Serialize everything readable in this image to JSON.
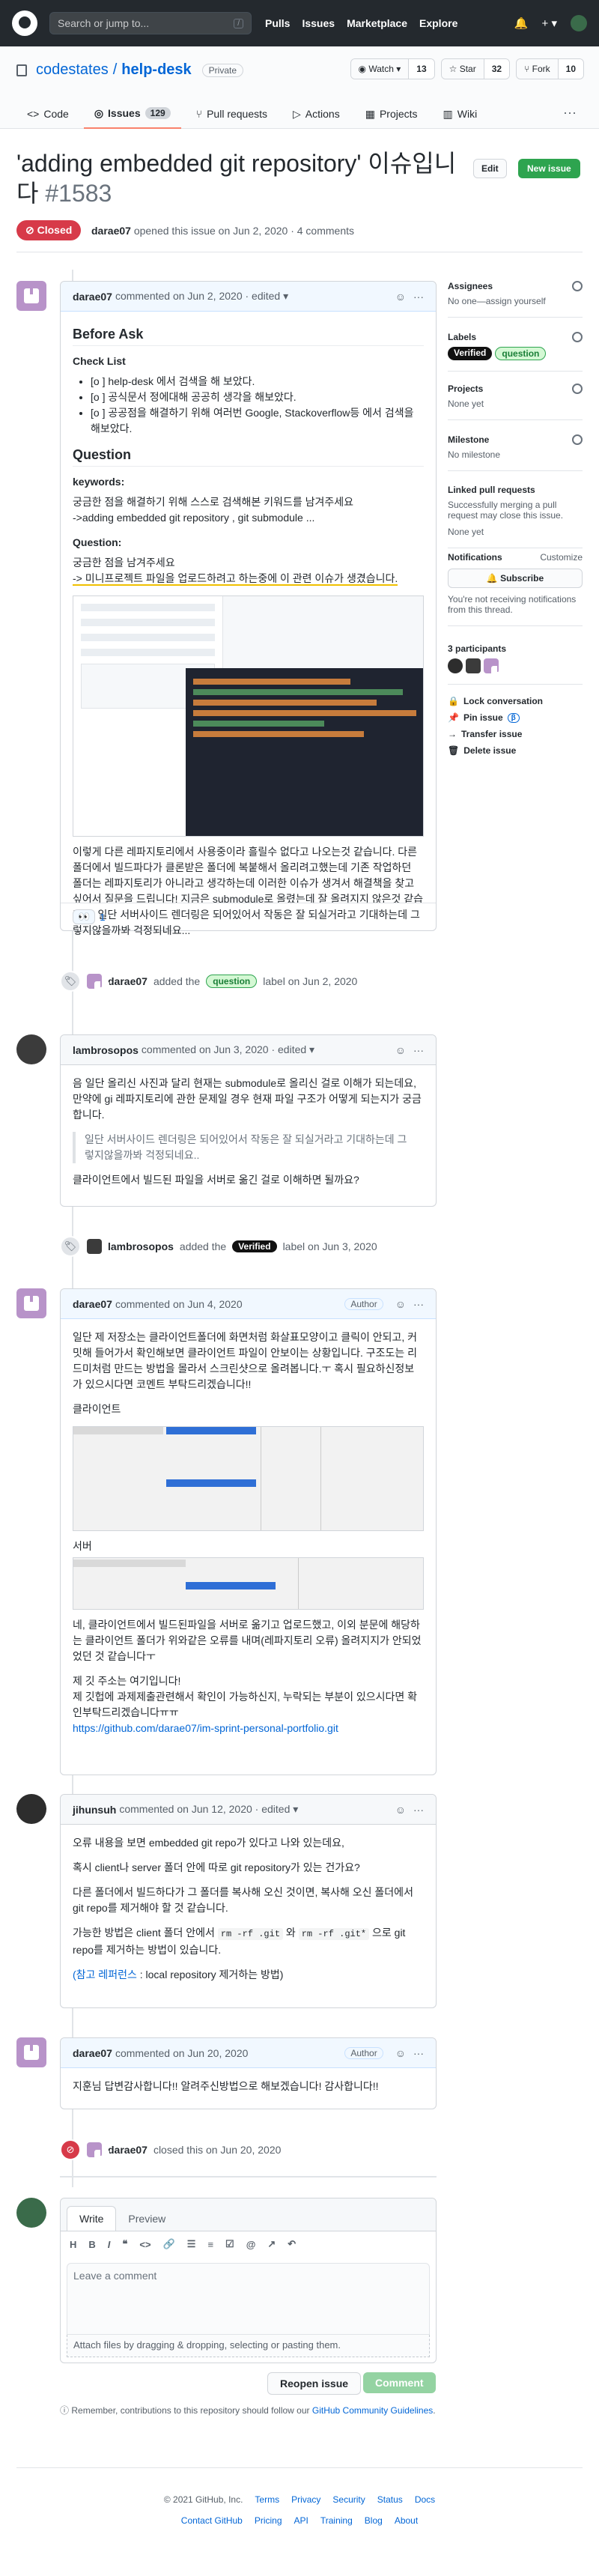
{
  "topbar": {
    "search_placeholder": "Search or jump to...",
    "slash": "/",
    "nav": [
      "Pulls",
      "Issues",
      "Marketplace",
      "Explore"
    ],
    "plus": "+ ▾"
  },
  "repo": {
    "owner": "codestates",
    "slash": "/",
    "name": "help-desk",
    "visibility": "Private",
    "watch": {
      "label": "◉ Watch ▾",
      "count": "13"
    },
    "star": {
      "label": "☆ Star",
      "count": "32"
    },
    "fork": {
      "label": "⑂ Fork",
      "count": "10"
    },
    "tabs": [
      {
        "label": "Code"
      },
      {
        "label": "Issues",
        "count": "129"
      },
      {
        "label": "Pull requests"
      },
      {
        "label": "Actions"
      },
      {
        "label": "Projects"
      },
      {
        "label": "Wiki"
      }
    ],
    "more": "···"
  },
  "issue": {
    "title": "'adding embedded git repository' 이슈입니다",
    "number": "#1583",
    "edit": "Edit",
    "new_issue": "New issue",
    "state": "⊘ Closed",
    "meta_user": "darae07",
    "meta_text": "opened this issue on Jun 2, 2020 · 4 comments"
  },
  "comments": [
    {
      "user": "darae07",
      "header": "commented on Jun 2, 2020 · edited ▾",
      "h_before": "Before Ask",
      "h_check": "Check List",
      "checks": [
        "[o ] help-desk 에서 검색을 해 보았다.",
        "[o ] 공식문서 정에대해 공공히 생각을 해보았다.",
        "[o ] 공공점을 해결하기 위해 여러번 Google, Stackoverflow등 에서 검색을 해보았다."
      ],
      "h_question": "Question",
      "kw_label": "keywords:",
      "kw1": "궁금한 점을 해결하기 위해 스스로 검색해본 키워드를 남겨주세요",
      "kw2": "->adding embedded git repository , git submodule ...",
      "q_label": "Question:",
      "q1": "궁금한 점을 남겨주세요",
      "q2": "-> 미니프로젝트 파일을 업로드하려고 하는중에 이 관련 이슈가 생겼습니다.",
      "body": "이렇게 다른 레파지토리에서 사용중이라 흘릴수 없다고 나오는것 같습니다. 다른 폴더에서 빌드파다가 클론받은 폴더에 복붙해서 올리려고했는데 기존 작업하던 폴더는 레파지토리가 아니라고 생각하는데 이러한 이슈가 생겨서 해결책을 찾고싶어서 질문을 드립니다! 지금은 submodule로 올렸는데 잘 올려지지 않은것 같습니다. 일단 서버사이드 렌더링은 되어있어서 작동은 잘 되실거라고 기대하는데 그렇지않을까봐 걱정되네요...",
      "reaction": "1"
    },
    {
      "user": "lambrosopos",
      "header": "commented on Jun 3, 2020 · edited ▾",
      "p1": "음 일단 올리신 사진과 달리 현재는 submodule로 올리신 걸로 이해가 되는데요, 만약에 gi 레파지토리에 관한 문제일 경우 현재 파일 구조가 어떻게 되는지가 궁금합니다.",
      "quote": "일단 서버사이드 렌더링은 되어있어서 작동은 잘 되실거라고 기대하는데 그렇지않을까봐 걱정되네요..",
      "p2": "클라이언트에서 빌드된 파일을 서버로 옮긴 걸로 이해하면 될까요?"
    },
    {
      "user": "darae07",
      "header": "commented on Jun 4, 2020",
      "badge": "Author",
      "p1": "일단 제 저장소는 클라이언트폴더에 화면처럼 화살표모양이고 클릭이 안되고, 커밋해 들어가서 확인해보면 클라이언트 파일이 안보이는 상황입니다. 구조도는 리드미처럼 만드는 방법을 몰라서 스크린샷으로 올려봅니다.ㅜ 혹시 필요하신정보가 있으시다면 코멘트 부탁드리겠습니다!!",
      "client_label": "클라이언트",
      "server_label": "서버",
      "p2": "네, 클라이언트에서 빌드된파일을 서버로 옮기고 업로드했고, 이외 분문에 해당하는 클라이언트 폴더가 위와같은 오류를 내며(레파지토리 오류) 올려지지가 안되었었던 것 같습니다ㅜ",
      "p3": "제 깃 주소는 여기입니다!",
      "p4": "제 깃헙에 과제제출관련해서 확인이 가능하신지, 누락되는 부분이 있으시다면 확인부탁드리겠습니다ㅠㅠ",
      "link": "https://github.com/darae07/im-sprint-personal-portfolio.git"
    },
    {
      "user": "jihunsuh",
      "header": "commented on Jun 12, 2020 · edited ▾",
      "p1": "오류 내용을 보면 embedded git repo가 있다고 나와 있는데요,",
      "p2": "혹시 client나 server 폴더 안에 따로 git repository가 있는 건가요?",
      "p3": "다른 폴더에서 빌드하다가 그 폴더를 복사해 오신 것이면, 복사해 오신 폴더에서 git repo를 제거해야 할 것 같습니다.",
      "p4a": "가능한 방법은 client 폴더 안에서",
      "code1": "rm -rf .git",
      "p4b": "와",
      "code2": "rm -rf .git*",
      "p4c": "으로 git repo를 제거하는 방법이 있습니다.",
      "ref_link": "(참고 레퍼런스",
      "ref_rest": ": local repository 제거하는 방법)"
    },
    {
      "user": "darae07",
      "header": "commented on Jun 20, 2020",
      "badge": "Author",
      "p1": "지훈님 답변감사합니다!! 알려주신방법으로 해보겠습니다! 감사합니다!!"
    }
  ],
  "events": [
    {
      "user": "darae07",
      "pre": "added the",
      "label": "question",
      "post": "label on Jun 2, 2020"
    },
    {
      "user": "lambrosopos",
      "pre": "added the",
      "label": "Verified",
      "post": "label on Jun 3, 2020"
    },
    {
      "user": "darae07",
      "pre": "closed this on Jun 20, 2020"
    }
  ],
  "sidebar": {
    "assignees": {
      "title": "Assignees",
      "text": "No one—assign yourself"
    },
    "labels": {
      "title": "Labels",
      "items": [
        "Verified",
        "question"
      ]
    },
    "projects": {
      "title": "Projects",
      "text": "None yet"
    },
    "milestone": {
      "title": "Milestone",
      "text": "No milestone"
    },
    "linked": {
      "title": "Linked pull requests",
      "text": "Successfully merging a pull request may close this issue.",
      "none": "None yet"
    },
    "notifications": {
      "title": "Notifications",
      "customize": "Customize",
      "button": "🔔 Subscribe",
      "text": "You're not receiving notifications from this thread."
    },
    "participants": {
      "title": "3 participants"
    },
    "actions": [
      "Lock conversation",
      "Pin issue",
      "Transfer issue",
      "Delete issue"
    ],
    "pin_beta": "β"
  },
  "editor": {
    "write": "Write",
    "preview": "Preview",
    "placeholder": "Leave a comment",
    "attach": "Attach files by dragging & dropping, selecting or pasting them.",
    "reopen": "Reopen issue",
    "comment": "Comment",
    "note_pre": "Remember, contributions to this repository should follow our",
    "note_link": "GitHub Community Guidelines",
    "note_post": "."
  },
  "footer": {
    "row1": [
      "© 2021 GitHub, Inc.",
      "Terms",
      "Privacy",
      "Security",
      "Status",
      "Docs"
    ],
    "row2": [
      "Contact GitHub",
      "Pricing",
      "API",
      "Training",
      "Blog",
      "About"
    ]
  },
  "colors": {
    "closed": "#d73a49",
    "new_issue": "#2ea44f",
    "link": "#0366d6"
  }
}
